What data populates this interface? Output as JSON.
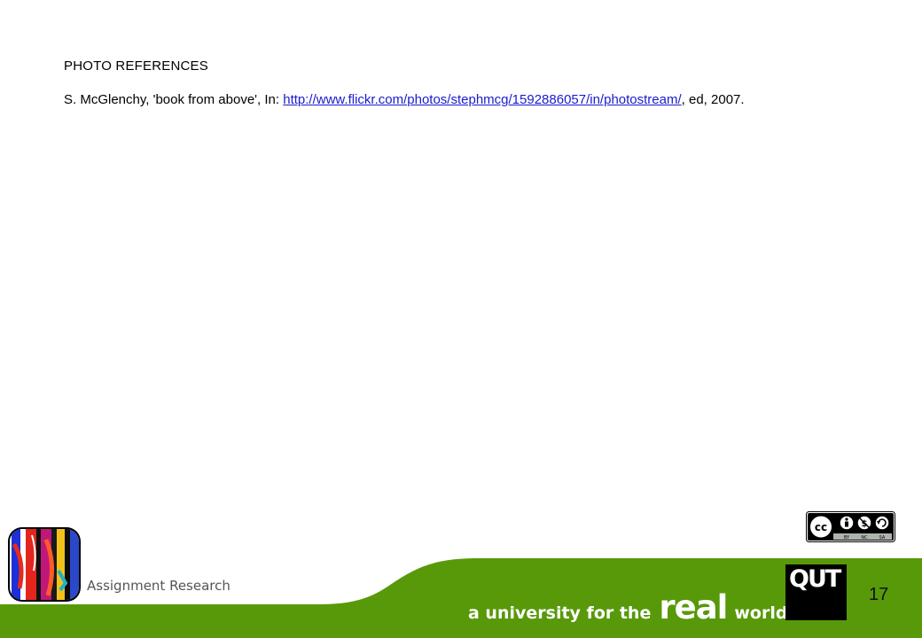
{
  "content": {
    "heading": "PHOTO REFERENCES",
    "reference": {
      "prefix": "S. McGlenchy, 'book from above', In: ",
      "link_text": "http://www.flickr.com/photos/stephmcg/1592886057/in/photostream/",
      "suffix": ", ed, 2007."
    }
  },
  "license": {
    "icons": [
      "cc-icon",
      "by-icon",
      "nc-icon",
      "sa-icon"
    ],
    "labels": [
      "BY",
      "NC",
      "SA"
    ]
  },
  "footer": {
    "label": "Assignment Research",
    "tagline": {
      "part1": "a university for the",
      "part2": "real",
      "part3": "world",
      "mark": "®"
    },
    "logo_text": "QUT",
    "page_number": "17"
  },
  "colors": {
    "footer_green": "#58990a",
    "link": "#1a1ad0",
    "logo_bg": "#000000"
  }
}
